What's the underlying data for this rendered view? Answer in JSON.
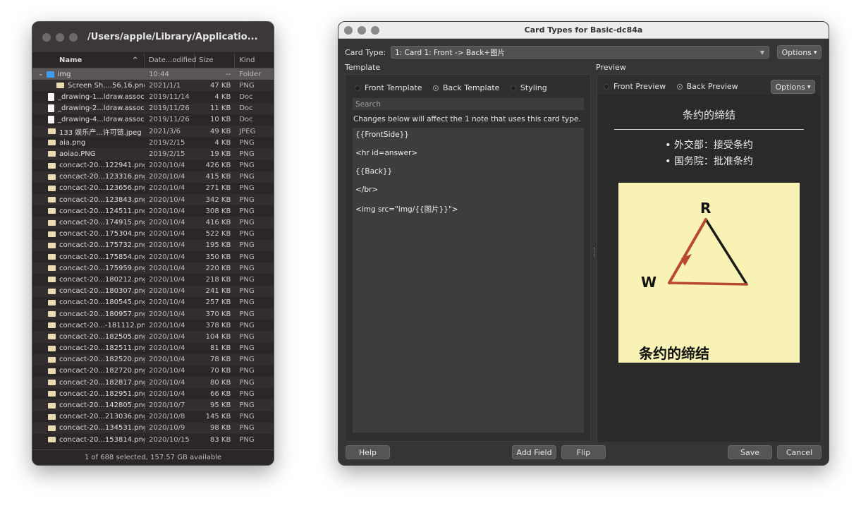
{
  "finder": {
    "path": "/Users/apple/Library/Applicatio...",
    "columns": {
      "name": "Name",
      "name_sort": "^",
      "date": "Date...odified",
      "size": "Size",
      "kind": "Kind"
    },
    "files": [
      {
        "name": "img",
        "date": "10:44",
        "size": "--",
        "kind": "Folder",
        "icon": "folder-icon",
        "selected": true,
        "expanded": true
      },
      {
        "name": "Screen Sh....56.16.png",
        "date": "2021/1/1",
        "size": "47 KB",
        "kind": "PNG",
        "icon": "image-icon",
        "indent": true
      },
      {
        "name": "_drawing-1...ldraw.assoc",
        "date": "2019/11/14",
        "size": "4 KB",
        "kind": "Doc",
        "icon": "document-icon"
      },
      {
        "name": "_drawing-2...ldraw.assoc",
        "date": "2019/11/26",
        "size": "11 KB",
        "kind": "Doc",
        "icon": "document-icon"
      },
      {
        "name": "_drawing-4...ldraw.assoc",
        "date": "2019/11/26",
        "size": "10 KB",
        "kind": "Doc",
        "icon": "document-icon"
      },
      {
        "name": "133 娱乐产...许可链.jpeg",
        "date": "2021/3/6",
        "size": "49 KB",
        "kind": "JPEG",
        "icon": "image-icon"
      },
      {
        "name": "aia.png",
        "date": "2019/2/15",
        "size": "4 KB",
        "kind": "PNG",
        "icon": "image-icon"
      },
      {
        "name": "aoiao.PNG",
        "date": "2019/2/15",
        "size": "19 KB",
        "kind": "PNG",
        "icon": "image-icon"
      },
      {
        "name": "concact-20...122941.png",
        "date": "2020/10/4",
        "size": "426 KB",
        "kind": "PNG",
        "icon": "image-icon"
      },
      {
        "name": "concact-20...123316.png",
        "date": "2020/10/4",
        "size": "415 KB",
        "kind": "PNG",
        "icon": "image-icon"
      },
      {
        "name": "concact-20...123656.png",
        "date": "2020/10/4",
        "size": "271 KB",
        "kind": "PNG",
        "icon": "image-icon"
      },
      {
        "name": "concact-20...123843.png",
        "date": "2020/10/4",
        "size": "342 KB",
        "kind": "PNG",
        "icon": "image-icon"
      },
      {
        "name": "concact-20...124511.png",
        "date": "2020/10/4",
        "size": "308 KB",
        "kind": "PNG",
        "icon": "image-icon"
      },
      {
        "name": "concact-20...174915.png",
        "date": "2020/10/4",
        "size": "416 KB",
        "kind": "PNG",
        "icon": "image-icon"
      },
      {
        "name": "concact-20...175304.png",
        "date": "2020/10/4",
        "size": "522 KB",
        "kind": "PNG",
        "icon": "image-icon"
      },
      {
        "name": "concact-20...175732.png",
        "date": "2020/10/4",
        "size": "195 KB",
        "kind": "PNG",
        "icon": "image-icon"
      },
      {
        "name": "concact-20...175854.png",
        "date": "2020/10/4",
        "size": "350 KB",
        "kind": "PNG",
        "icon": "image-icon"
      },
      {
        "name": "concact-20...175959.png",
        "date": "2020/10/4",
        "size": "220 KB",
        "kind": "PNG",
        "icon": "image-icon"
      },
      {
        "name": "concact-20...180212.png",
        "date": "2020/10/4",
        "size": "218 KB",
        "kind": "PNG",
        "icon": "image-icon"
      },
      {
        "name": "concact-20...180307.png",
        "date": "2020/10/4",
        "size": "241 KB",
        "kind": "PNG",
        "icon": "image-icon"
      },
      {
        "name": "concact-20...180545.png",
        "date": "2020/10/4",
        "size": "257 KB",
        "kind": "PNG",
        "icon": "image-icon"
      },
      {
        "name": "concact-20...180957.png",
        "date": "2020/10/4",
        "size": "370 KB",
        "kind": "PNG",
        "icon": "image-icon"
      },
      {
        "name": "concact-20...-181112.png",
        "date": "2020/10/4",
        "size": "378 KB",
        "kind": "PNG",
        "icon": "image-icon"
      },
      {
        "name": "concact-20...182505.png",
        "date": "2020/10/4",
        "size": "104 KB",
        "kind": "PNG",
        "icon": "image-icon"
      },
      {
        "name": "concact-20...182511.png",
        "date": "2020/10/4",
        "size": "81 KB",
        "kind": "PNG",
        "icon": "image-icon"
      },
      {
        "name": "concact-20...182520.png",
        "date": "2020/10/4",
        "size": "78 KB",
        "kind": "PNG",
        "icon": "image-icon"
      },
      {
        "name": "concact-20...182720.png",
        "date": "2020/10/4",
        "size": "70 KB",
        "kind": "PNG",
        "icon": "image-icon"
      },
      {
        "name": "concact-20...182817.png",
        "date": "2020/10/4",
        "size": "80 KB",
        "kind": "PNG",
        "icon": "image-icon"
      },
      {
        "name": "concact-20...182951.png",
        "date": "2020/10/4",
        "size": "66 KB",
        "kind": "PNG",
        "icon": "image-icon"
      },
      {
        "name": "concact-20...142805.png",
        "date": "2020/10/7",
        "size": "95 KB",
        "kind": "PNG",
        "icon": "image-icon"
      },
      {
        "name": "concact-20...213036.png",
        "date": "2020/10/8",
        "size": "145 KB",
        "kind": "PNG",
        "icon": "image-icon"
      },
      {
        "name": "concact-20...134531.png",
        "date": "2020/10/9",
        "size": "98 KB",
        "kind": "PNG",
        "icon": "image-icon"
      },
      {
        "name": "concact-20...153814.png",
        "date": "2020/10/15",
        "size": "83 KB",
        "kind": "PNG",
        "icon": "image-icon"
      }
    ],
    "status": "1 of 688 selected, 157.57 GB available"
  },
  "anki": {
    "window_title": "Card Types for Basic-dc84a",
    "card_type_label": "Card Type:",
    "card_type_value": "1: Card 1: Front -> Back+图片",
    "options_label": "Options",
    "template_label": "Template",
    "preview_label": "Preview",
    "template_tabs": [
      "Front Template",
      "Back Template",
      "Styling"
    ],
    "template_selected": "Back Template",
    "search_placeholder": "Search",
    "notice": "Changes below will affect the 1 note that uses this card type.",
    "template_lines": [
      "{{FrontSide}}",
      "<hr id=answer>",
      "{{Back}}",
      "</br>",
      "<img src=\"img/{{图片}}\">"
    ],
    "preview_tabs": [
      "Front Preview",
      "Back Preview"
    ],
    "preview_selected": "Back Preview",
    "preview_options_label": "Options",
    "card": {
      "title": "条约的缔结",
      "bullets": [
        "• 外交部：接受条约",
        "• 国务院：批准条约"
      ],
      "image_labels": {
        "top": "R",
        "left": "W",
        "caption": "条约的缔结"
      }
    },
    "buttons": {
      "help": "Help",
      "add_field": "Add Field",
      "flip": "Flip",
      "save": "Save",
      "cancel": "Cancel"
    }
  },
  "colors": {
    "accent_red": "#b8492e",
    "sticky": "#f8f3b5",
    "folder": "#3d9be9"
  }
}
